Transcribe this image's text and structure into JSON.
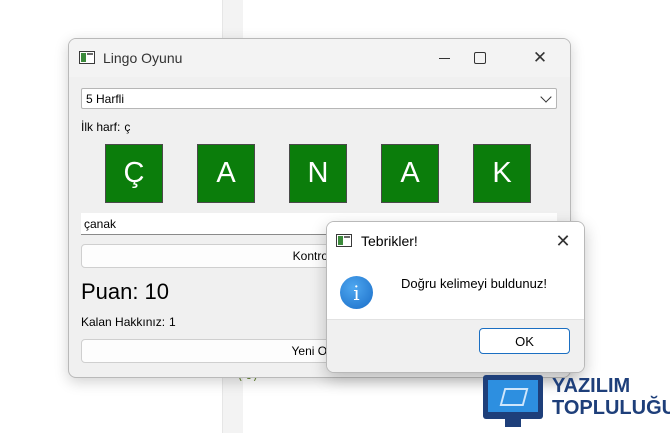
{
  "background": {
    "code_fragment": "(t)",
    "code_paren": ")"
  },
  "window": {
    "title": "Lingo Oyunu",
    "close_glyph": "✕"
  },
  "combo": {
    "selected": "5 Harfli"
  },
  "first_letter": {
    "label": "İlk harf:",
    "value": "ç"
  },
  "tiles": [
    "Ç",
    "A",
    "N",
    "A",
    "K"
  ],
  "guess": {
    "value": "çanak"
  },
  "buttons": {
    "check": "Kontrol Et",
    "new_game": "Yeni Oyun"
  },
  "score": {
    "label": "Puan:",
    "value": "10"
  },
  "remaining": {
    "label": "Kalan Hakkınız:",
    "value": "1"
  },
  "dialog": {
    "title": "Tebrikler!",
    "close_glyph": "✕",
    "icon_glyph": "i",
    "message": "Doğru kelimeyi buldunuz!",
    "ok_label": "OK"
  },
  "logo": {
    "line1": "YAZILIM",
    "line2": "TOPLULUĞU"
  },
  "colors": {
    "tile_green": "#0b7d0b",
    "dialog_button_accent": "#1b6fc2",
    "info_icon_blue": "#1a6dc7",
    "logo_navy": "#1e3f7a"
  }
}
